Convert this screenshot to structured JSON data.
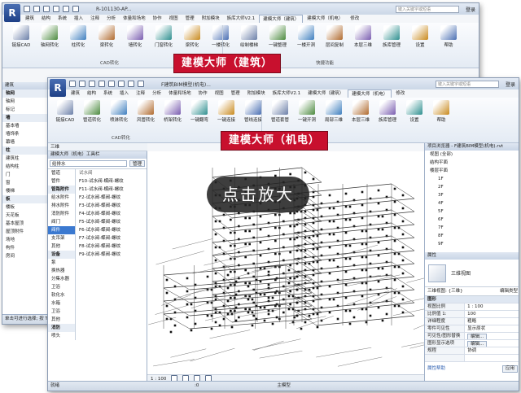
{
  "back": {
    "doc_title": "R-101130-AP...",
    "search_placeholder": "键入关键字或短语",
    "login": "登录",
    "tabs": [
      "建筑",
      "结构",
      "系统",
      "插入",
      "注释",
      "分析",
      "体量和场地",
      "协作",
      "视图",
      "管理",
      "附加模块",
      "族库大师V2.1",
      "建模大师（建筑）",
      "建模大师（机电）",
      "修改"
    ],
    "active_tab": 12,
    "ribbon_buttons": [
      "链接CAD",
      "轴网转化",
      "柱转化",
      "梁转化",
      "墙转化",
      "门窗转化",
      "梁转化",
      "一楼转化",
      "绘制楼梯",
      "一键整理",
      "一楼开洞",
      "层间复制",
      "本层三维",
      "族库管理",
      "设置",
      "帮助"
    ],
    "groups": [
      "CAD转化",
      "快捷功能"
    ],
    "banner": "建模大师（建筑）",
    "left_panel": {
      "header": "建筑",
      "items": [
        {
          "label": "轴网",
          "cat": true
        },
        {
          "label": "轴网",
          "cat": false
        },
        {
          "label": "标记",
          "cat": false
        },
        {
          "label": "墙",
          "cat": true
        },
        {
          "label": "基本墙",
          "cat": false
        },
        {
          "label": "墙饰条",
          "cat": false
        },
        {
          "label": "幕墙",
          "cat": false
        },
        {
          "label": "柱",
          "cat": true
        },
        {
          "label": "建筑柱",
          "cat": false
        },
        {
          "label": "结构柱",
          "cat": false
        },
        {
          "label": "门",
          "cat": false
        },
        {
          "label": "窗",
          "cat": false
        },
        {
          "label": "楼梯",
          "cat": false
        },
        {
          "label": "板",
          "cat": true
        },
        {
          "label": "楼板",
          "cat": false
        },
        {
          "label": "天花板",
          "cat": false
        },
        {
          "label": "基本屋顶",
          "cat": false
        },
        {
          "label": "屋顶附件",
          "cat": false
        },
        {
          "label": "场地",
          "cat": false
        },
        {
          "label": "构件",
          "cat": false
        },
        {
          "label": "房间",
          "cat": false
        }
      ]
    },
    "status": "单击可进行选择; 按 Tab"
  },
  "front": {
    "doc_title": "F建筑BIM模型(机电)...",
    "search_placeholder": "键入关键字或短语",
    "login": "登录",
    "tabs": [
      "建筑",
      "结构",
      "系统",
      "插入",
      "注释",
      "分析",
      "体量和场地",
      "协作",
      "视图",
      "管理",
      "附加模块",
      "族库大师V2.1",
      "建模大师（建筑）",
      "建模大师（机电）",
      "修改"
    ],
    "active_tab": 13,
    "ribbon_buttons": [
      "链接CAD",
      "管道转化",
      "喷淋转化",
      "风管转化",
      "桥架转化",
      "一键翻弯",
      "一键连接",
      "管线连接",
      "管道套管",
      "一键开洞",
      "局部三维",
      "本层三维",
      "族库管理",
      "设置",
      "帮助"
    ],
    "groups": [
      "CAD转化"
    ],
    "banner": "建模大师（机电）",
    "view_selector": "三维",
    "left_panel": {
      "header": "建模大师（机电）工具栏",
      "dropdown": "给排水",
      "manage_btn": "管理",
      "categories": [
        {
          "label": "管道",
          "cat": false,
          "sel": false
        },
        {
          "label": "管件",
          "cat": false,
          "sel": false
        },
        {
          "label": "管路附件",
          "cat": true,
          "sel": false
        },
        {
          "label": "给水附件",
          "cat": false,
          "sel": false
        },
        {
          "label": "排水附件",
          "cat": false,
          "sel": false
        },
        {
          "label": "消防附件",
          "cat": false,
          "sel": false
        },
        {
          "label": "阀门",
          "cat": false,
          "sel": false
        },
        {
          "label": "阀件",
          "cat": false,
          "sel": true
        },
        {
          "label": "支吊架",
          "cat": false,
          "sel": false
        },
        {
          "label": "其他",
          "cat": false,
          "sel": false
        },
        {
          "label": "设备",
          "cat": true,
          "sel": false
        },
        {
          "label": "泵",
          "cat": false,
          "sel": false
        },
        {
          "label": "换热器",
          "cat": false,
          "sel": false
        },
        {
          "label": "分集水器",
          "cat": false,
          "sel": false
        },
        {
          "label": "卫浴",
          "cat": false,
          "sel": false
        },
        {
          "label": "软化水",
          "cat": false,
          "sel": false
        },
        {
          "label": "水箱",
          "cat": false,
          "sel": false
        },
        {
          "label": "卫浴",
          "cat": false,
          "sel": false
        },
        {
          "label": "其他",
          "cat": false,
          "sel": false
        },
        {
          "label": "消防",
          "cat": true,
          "sel": false
        },
        {
          "label": "喷头",
          "cat": false,
          "sel": false
        }
      ],
      "list_header": "试水阀",
      "list": [
        "F10-试水阀-蝶阀-螺纹",
        "F11-试水阀-蝶阀-螺纹",
        "F2-试水阀-蝶阀-螺纹",
        "F3-试水阀-蝶阀-螺纹",
        "F4-试水阀-蝶阀-螺纹",
        "F5-试水阀-蝶阀-螺纹",
        "F6-试水阀-蝶阀-螺纹",
        "F7-试水阀-蝶阀-螺纹",
        "F8-试水阀-蝶阀-螺纹",
        "F9-试水阀-蝶阀-螺纹"
      ]
    },
    "project_browser": {
      "header": "项目浏览器 - F建筑BIM模型(机电).rvt",
      "tree": [
        "视图 (全部)",
        "结构平面",
        "楼层平面",
        "1F",
        "2F",
        "3F",
        "4F",
        "5F",
        "6F",
        "7F",
        "8F",
        "9F"
      ]
    },
    "properties": {
      "header": "属性",
      "type_name": "三维视图",
      "view_dropdown": "三维视图: {三维}",
      "edit_type": "编辑类型",
      "section": "图形",
      "rows": [
        {
          "k": "视图比例",
          "v": "1 : 100"
        },
        {
          "k": "比例值 1:",
          "v": "100"
        },
        {
          "k": "详细程度",
          "v": "粗略"
        },
        {
          "k": "零件可见性",
          "v": "显示原状"
        },
        {
          "k": "可见性/图形替换",
          "v": "编辑..."
        },
        {
          "k": "图形显示选项",
          "v": "编辑..."
        },
        {
          "k": "规程",
          "v": "协调"
        },
        {
          "k": "",
          "v": ""
        }
      ],
      "help": "属性帮助",
      "apply": "应用"
    },
    "view_scale": "1 : 100",
    "status": "就绪",
    "status_model": "主模型",
    "status_count": ":0"
  },
  "overlay": {
    "zoom_label": "点击放大"
  },
  "colors": {
    "banner": "#c8102e",
    "accent": "#3b79d0",
    "ribbon": "#e4ebf4"
  }
}
